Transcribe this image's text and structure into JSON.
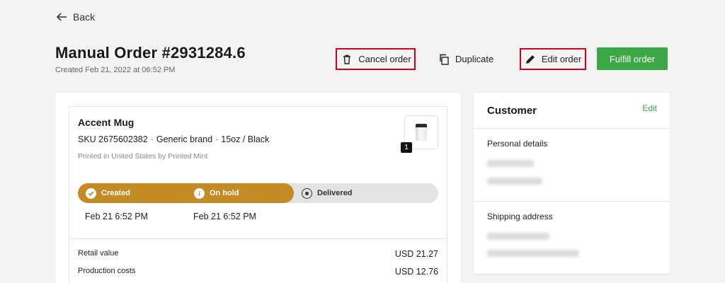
{
  "nav": {
    "back_label": "Back"
  },
  "order": {
    "title": "Manual Order #2931284.6",
    "created": "Created Feb 21, 2022 at 06:52 PM"
  },
  "actions": {
    "cancel": "Cancel order",
    "duplicate": "Duplicate",
    "edit": "Edit order",
    "fulfill": "Fulfill order"
  },
  "item": {
    "name": "Accent Mug",
    "sku": "SKU 2675602382",
    "brand": "Generic brand",
    "variant": "15oz / Black",
    "printed": "Printed in United States by Printed Mint",
    "quantity": "1"
  },
  "status": {
    "progress_fraction": 0.6,
    "steps": [
      {
        "label": "Created",
        "icon": "check-icon"
      },
      {
        "label": "On hold",
        "icon": "info-icon"
      },
      {
        "label": "Delivered",
        "icon": "radio-icon"
      }
    ],
    "dates": [
      "Feb 21 6:52 PM",
      "Feb 21 6:52 PM"
    ]
  },
  "costs": [
    {
      "label": "Retail value",
      "value": "USD 21.27"
    },
    {
      "label": "Production costs",
      "value": "USD 12.76"
    }
  ],
  "customer": {
    "title": "Customer",
    "edit": "Edit",
    "personal_heading": "Personal details",
    "shipping_heading": "Shipping address"
  },
  "colors": {
    "accent_green": "#3ca745",
    "status_gold": "#c48a23",
    "highlight_red": "#d0021b"
  }
}
